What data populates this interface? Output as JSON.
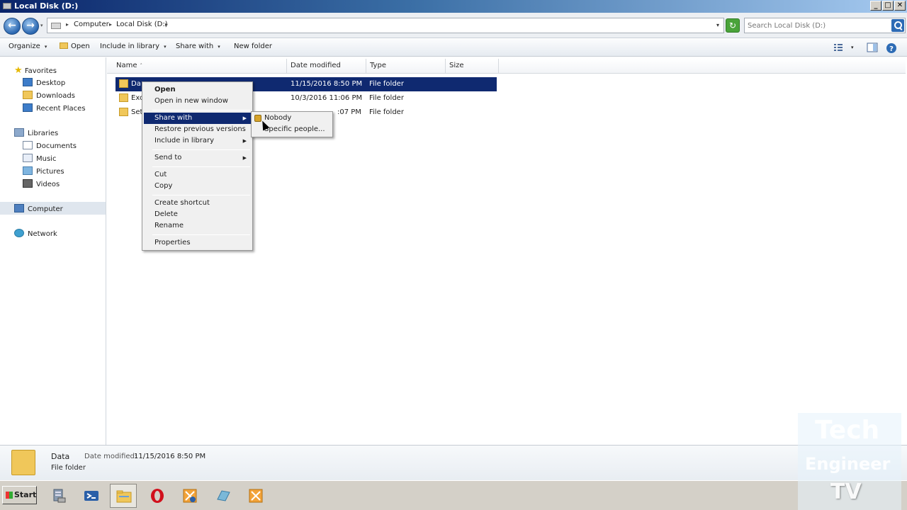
{
  "window": {
    "title": "Local Disk (D:)",
    "minimize": "_",
    "maximize": "□",
    "close": "✕"
  },
  "address": {
    "back": "←",
    "forward": "→",
    "crumbs": [
      "Computer",
      "Local Disk (D:)"
    ],
    "crumb_arrow": "▸",
    "search_placeholder": "Search Local Disk (D:)",
    "icons": [
      "back-icon",
      "forward-icon",
      "drive-icon",
      "refresh-icon",
      "search-icon"
    ]
  },
  "toolbar": {
    "organize": "Organize",
    "open": "Open",
    "include_in_library": "Include in library",
    "share_with": "Share with",
    "new_folder": "New folder",
    "dropdown_arrow": "▾"
  },
  "navpane": {
    "favorites": "Favorites",
    "desktop": "Desktop",
    "downloads": "Downloads",
    "recent_places": "Recent Places",
    "libraries": "Libraries",
    "documents": "Documents",
    "music": "Music",
    "pictures": "Pictures",
    "videos": "Videos",
    "computer": "Computer",
    "network": "Network"
  },
  "columns": {
    "name": "Name",
    "date_modified": "Date modified",
    "type": "Type",
    "size": "Size",
    "sort_arrow": "˄"
  },
  "files": [
    {
      "name": "Data",
      "name_visible": "Da",
      "date": "11/15/2016 8:50 PM",
      "type": "File folder",
      "selected": true
    },
    {
      "name": "Exc",
      "name_visible": "Exc",
      "date": "10/3/2016 11:06 PM",
      "type": "File folder",
      "selected": false
    },
    {
      "name": "Set",
      "name_visible": "Set",
      "date": ":07 PM",
      "type": "File folder",
      "selected": false
    }
  ],
  "context_menu": {
    "open": "Open",
    "open_new_window": "Open in new window",
    "share_with": "Share with",
    "restore_previous": "Restore previous versions",
    "include_in_library": "Include in library",
    "send_to": "Send to",
    "cut": "Cut",
    "copy": "Copy",
    "create_shortcut": "Create shortcut",
    "delete": "Delete",
    "rename": "Rename",
    "properties": "Properties",
    "submenu_arrow": "▶"
  },
  "share_submenu": {
    "nobody": "Nobody",
    "specific_people": "Specific people..."
  },
  "details": {
    "name": "Data",
    "date_modified_label": "Date modified:",
    "date_modified_value": "11/15/2016 8:50 PM",
    "type": "File folder"
  },
  "taskbar": {
    "start": "Start",
    "apps": [
      "server-manager-icon",
      "powershell-icon",
      "explorer-icon",
      "opera-icon",
      "app-icon-4",
      "app-icon-5",
      "app-icon-6"
    ]
  },
  "watermark": {
    "line1": "Tech",
    "line2": "Engineer",
    "line3": "TV"
  },
  "colors": {
    "selection": "#0f2970",
    "title_start": "#0a246a",
    "title_end": "#a6caf0"
  }
}
